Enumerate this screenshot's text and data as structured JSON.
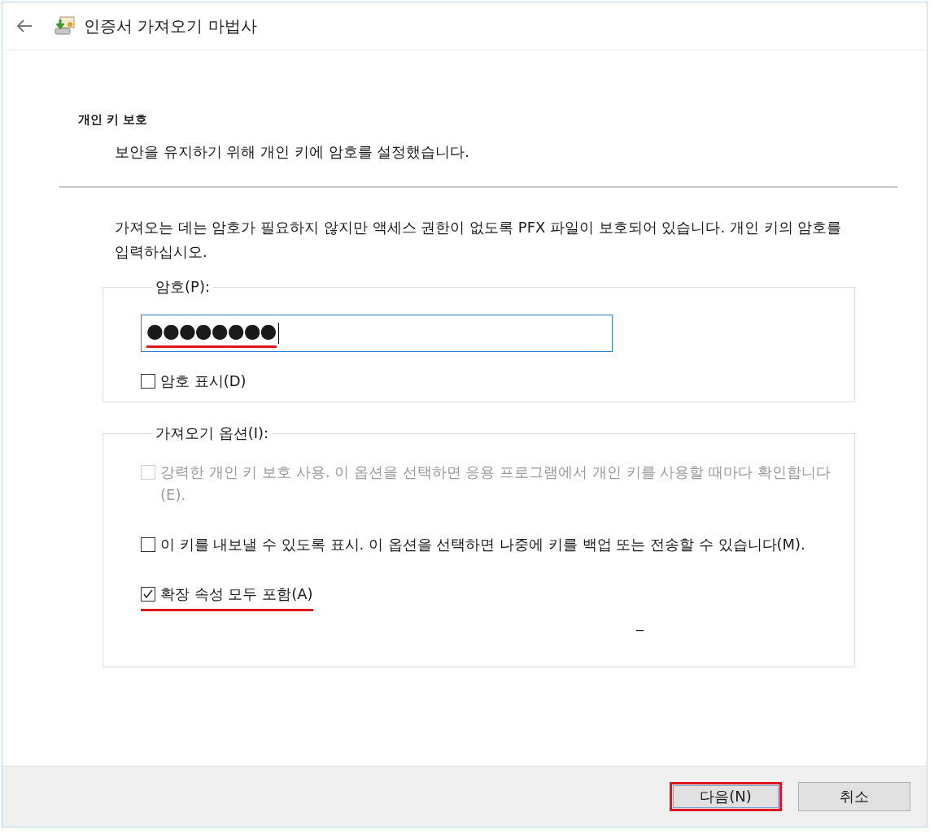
{
  "window": {
    "title": "인증서 가져오기 마법사"
  },
  "page": {
    "heading": "개인 키 보호",
    "subheading": "보안을 유지하기 위해 개인 키에 암호를 설정했습니다."
  },
  "description": "가져오는 데는 암호가 필요하지 않지만 액세스 권한이 없도록 PFX 파일이 보호되어 있습니다. 개인 키의 암호를 입력하십시오.",
  "password_group": {
    "label": "암호(P):",
    "value": "●●●●●●●●",
    "highlighted": true,
    "show_password": {
      "label": "암호 표시(D)",
      "checked": false,
      "disabled": false
    }
  },
  "options_group": {
    "label": "가져오기 옵션(I):",
    "options": [
      {
        "label": "강력한 개인 키 보호 사용. 이 옵션을 선택하면 응용 프로그램에서 개인 키를 사용할 때마다 확인합니다(E).",
        "checked": false,
        "disabled": true,
        "highlighted": false
      },
      {
        "label": "이 키를 내보낼 수 있도록 표시. 이 옵션을 선택하면 나중에 키를 백업 또는 전송할 수 있습니다(M).",
        "checked": false,
        "disabled": false,
        "highlighted": false
      },
      {
        "label": "확장 속성 모두 포함(A)",
        "checked": true,
        "disabled": false,
        "highlighted": true
      }
    ],
    "stray_mark": "_"
  },
  "buttons": [
    {
      "label": "다음(N)",
      "highlighted": true
    },
    {
      "label": "취소",
      "highlighted": false
    }
  ]
}
